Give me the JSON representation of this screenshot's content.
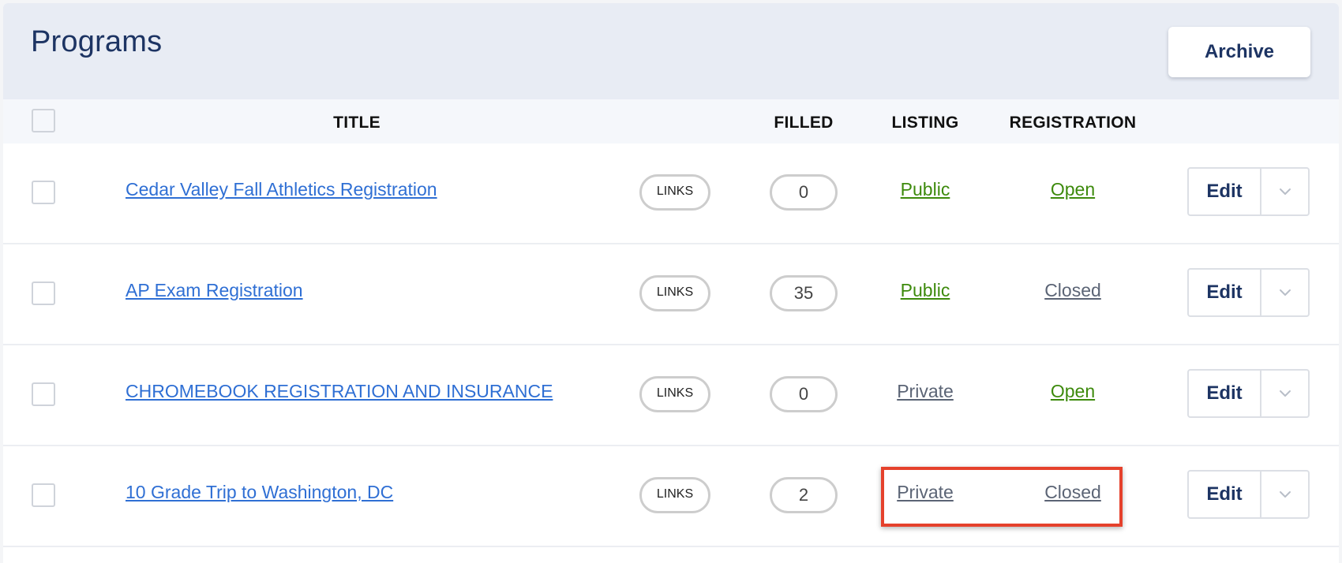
{
  "page": {
    "title": "Programs",
    "archive_label": "Archive"
  },
  "columns": {
    "title": "TITLE",
    "filled": "FILLED",
    "listing": "LISTING",
    "registration": "REGISTRATION"
  },
  "colors": {
    "link_blue": "#2f6fd4",
    "status_green": "#3d8a0c",
    "status_gray": "#5b6475",
    "navy": "#1d3463",
    "highlight_red": "#e5412c"
  },
  "rows": [
    {
      "title": "Cedar Valley Fall Athletics Registration",
      "links": "LINKS",
      "filled": "0",
      "listing": "Public",
      "listing_state": "green",
      "registration": "Open",
      "registration_state": "green",
      "edit": "Edit"
    },
    {
      "title": "AP Exam Registration",
      "links": "LINKS",
      "filled": "35",
      "listing": "Public",
      "listing_state": "green",
      "registration": "Closed",
      "registration_state": "gray",
      "edit": "Edit"
    },
    {
      "title": "CHROMEBOOK REGISTRATION AND INSURANCE",
      "links": "LINKS",
      "filled": "0",
      "listing": "Private",
      "listing_state": "gray",
      "registration": "Open",
      "registration_state": "green",
      "edit": "Edit"
    },
    {
      "title": "10 Grade Trip to Washington, DC",
      "links": "LINKS",
      "filled": "2",
      "listing": "Private",
      "listing_state": "gray",
      "registration": "Closed",
      "registration_state": "gray",
      "edit": "Edit"
    }
  ]
}
